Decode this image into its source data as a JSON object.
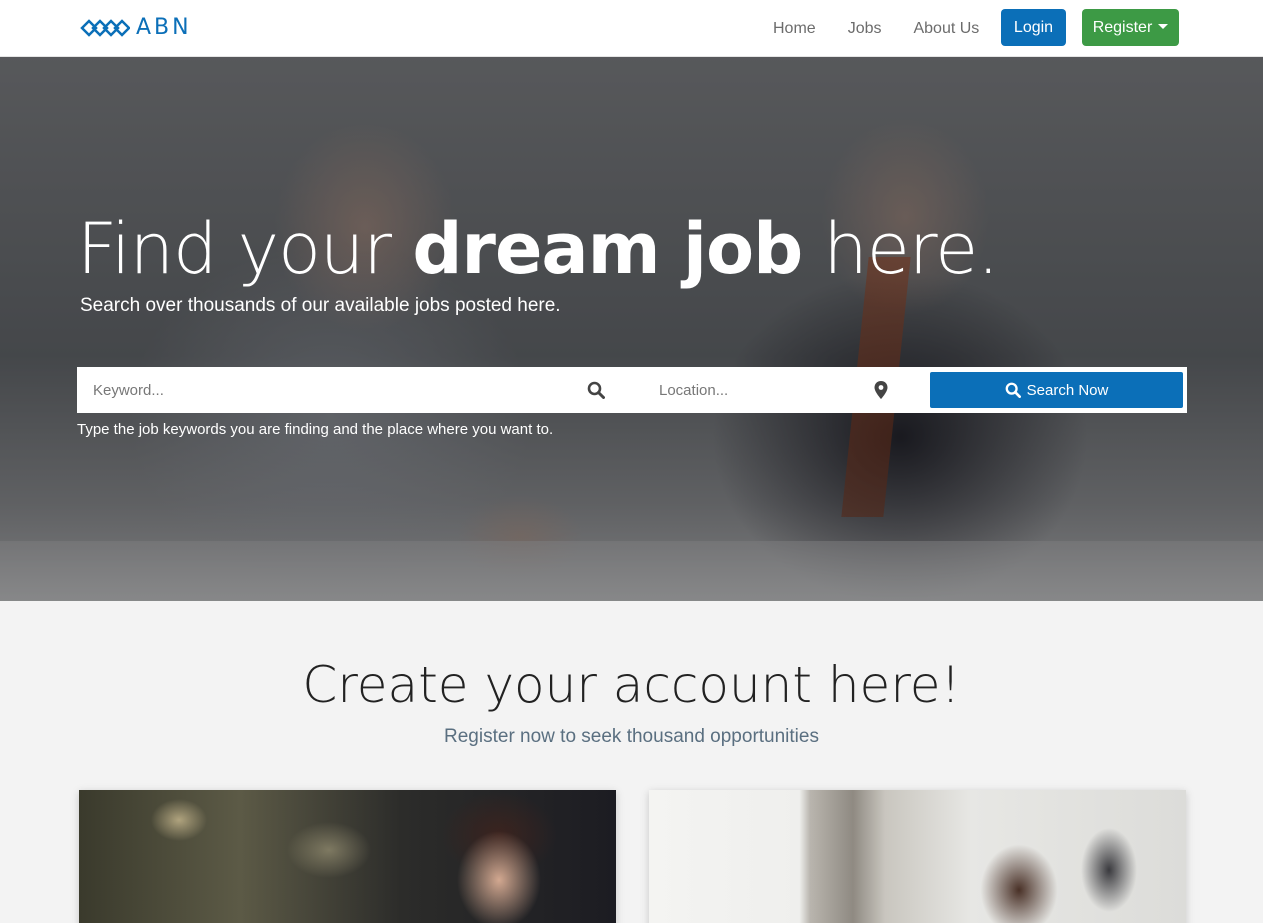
{
  "brand": {
    "name": "ABN",
    "color": "#0b6fb8"
  },
  "nav": {
    "links": [
      {
        "label": "Home"
      },
      {
        "label": "Jobs"
      },
      {
        "label": "About Us"
      }
    ],
    "login_label": "Login",
    "register_label": "Register"
  },
  "hero": {
    "title_light_1": "Find your ",
    "title_bold": "dream job",
    "title_light_2": " here.",
    "subtitle": "Search over thousands of our available jobs posted here.",
    "keyword_placeholder": "Keyword...",
    "location_placeholder": "Location...",
    "search_button_label": "Search Now",
    "hint": "Type the job keywords you are finding and the place where you want to."
  },
  "account": {
    "title": "Create your account here!",
    "subtitle": "Register now to seek thousand opportunities"
  },
  "colors": {
    "primary": "#0b6fb8",
    "success": "#3d9a45",
    "page_background": "#f3f3f3"
  },
  "icons": {
    "search": "search-icon",
    "location": "map-pin-icon",
    "caret": "caret-down-icon"
  }
}
